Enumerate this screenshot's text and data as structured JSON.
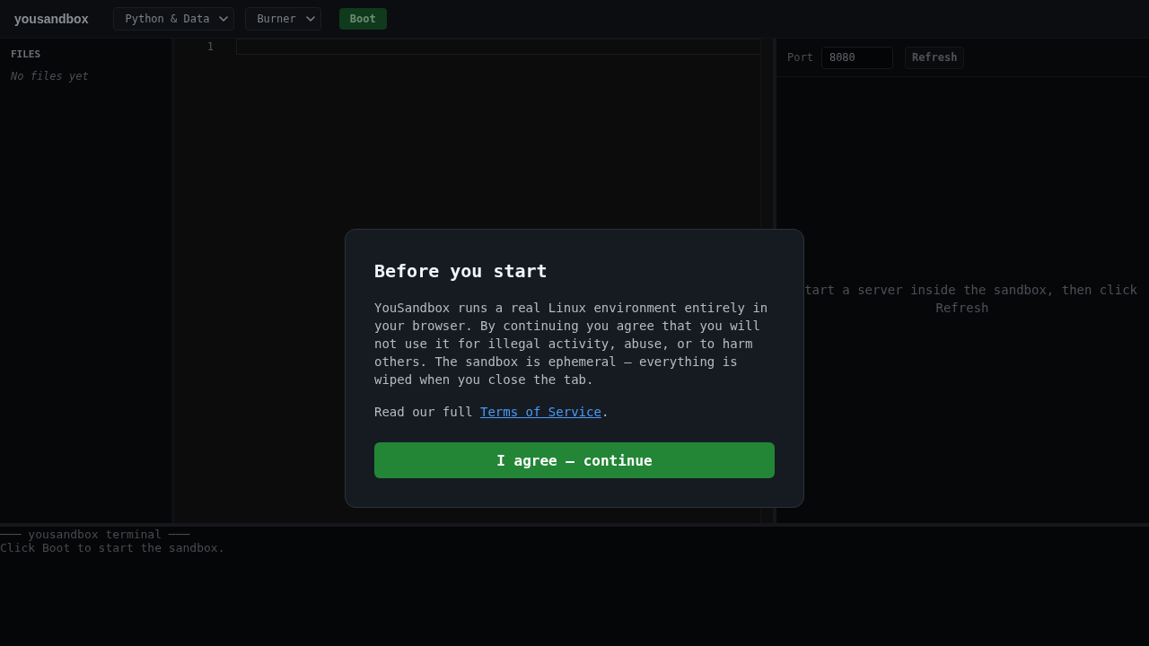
{
  "header": {
    "logo": "yousandbox",
    "dropdowns": [
      {
        "value": "Python & Data"
      },
      {
        "value": "Burner"
      }
    ],
    "boot_button": "Boot"
  },
  "sidebar": {
    "title": "FILES",
    "empty_text": "No files yet"
  },
  "editor": {
    "line_numbers": [
      "1"
    ]
  },
  "preview": {
    "port_label": "Port",
    "port_value": "8080",
    "refresh_button": "Refresh",
    "message": "tart a server inside the sandbox, then click Refresh"
  },
  "terminal": {
    "lines": [
      "─── yousandbox terminal ───",
      "Click Boot to start the sandbox."
    ]
  },
  "dialog": {
    "title": "Before you start",
    "text": "YouSandbox runs a real Linux environment entirely in your browser. By continuing you agree that you will not use it for illegal activity, abuse, or to harm others. The sandbox is ephemeral — everything is wiped when you close the tab.",
    "terms": {
      "before": "Read our full",
      "link": "Terms of Service",
      "after": "."
    },
    "button": "I agree — continue"
  }
}
